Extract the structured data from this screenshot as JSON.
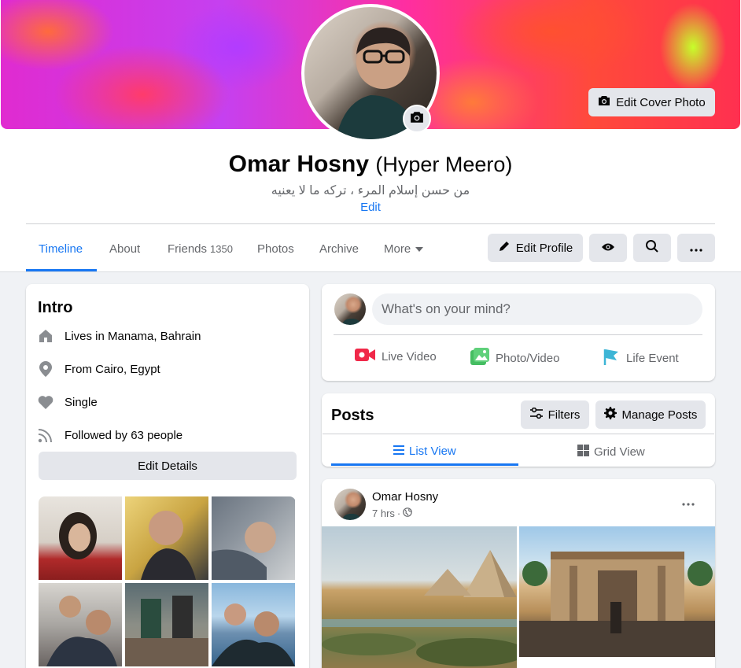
{
  "cover": {
    "edit_label": "Edit Cover Photo"
  },
  "profile": {
    "name": "Omar Hosny",
    "alt_name": "(Hyper Meero)",
    "bio": "من حسن إسلام المرء ، تركه ما لا يعنيه",
    "bio_edit": "Edit"
  },
  "tabs": [
    {
      "label": "Timeline",
      "active": true
    },
    {
      "label": "About"
    },
    {
      "label": "Friends",
      "count": "1350"
    },
    {
      "label": "Photos"
    },
    {
      "label": "Archive"
    },
    {
      "label": "More"
    }
  ],
  "header_actions": {
    "edit_profile": "Edit Profile"
  },
  "intro": {
    "title": "Intro",
    "lives_prefix": "Lives in",
    "lives_place": "Manama, Bahrain",
    "from_prefix": "From",
    "from_place": "Cairo, Egypt",
    "relationship": "Single",
    "followed_prefix": "Followed by",
    "followed_count": "63 people",
    "edit_details": "Edit Details"
  },
  "composer": {
    "placeholder": "What's on your mind?",
    "live_video": "Live Video",
    "photo_video": "Photo/Video",
    "life_event": "Life Event"
  },
  "posts": {
    "title": "Posts",
    "filters": "Filters",
    "manage": "Manage Posts",
    "list_view": "List View",
    "grid_view": "Grid View"
  },
  "post": {
    "author": "Omar Hosny",
    "time": "7 hrs",
    "separator": "·"
  },
  "colors": {
    "accent": "#1877f2",
    "live": "#f02849",
    "photo": "#45bd62",
    "event": "#3db5d6"
  }
}
